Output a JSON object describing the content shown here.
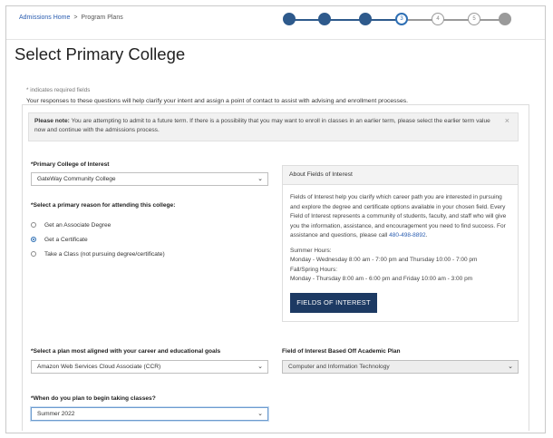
{
  "breadcrumb": {
    "home": "Admissions Home",
    "separator": ">",
    "current": "Program Plans"
  },
  "progress": {
    "steps": [
      {
        "label": "",
        "state": "done"
      },
      {
        "label": "",
        "state": "done"
      },
      {
        "label": "",
        "state": "done"
      },
      {
        "label": "3",
        "state": "current"
      },
      {
        "label": "4",
        "state": "todo"
      },
      {
        "label": "5",
        "state": "todo"
      },
      {
        "label": "",
        "state": "last"
      }
    ]
  },
  "page": {
    "title": "Select Primary College",
    "required_note": "* indicates required fields",
    "intro": "Your responses to these questions will help clarify your intent and assign a point of contact to assist with advising and enrollment processes."
  },
  "notice": {
    "prefix": "Please note:",
    "text": " You are attempting to admit to a future term. If there is a possibility that you may want to enroll in classes in an earlier term, please select the earlier term value now and continue with the admissions process.",
    "close": "×"
  },
  "college": {
    "label": "*Primary College of Interest",
    "value": "GateWay Community College"
  },
  "reason": {
    "label": "*Select a primary reason for attending this college:",
    "options": [
      {
        "label": "Get an Associate Degree",
        "checked": false
      },
      {
        "label": "Get a Certificate",
        "checked": true
      },
      {
        "label": "Take a Class (not pursuing degree/certificate)",
        "checked": false
      }
    ]
  },
  "about": {
    "title": "About Fields of Interest",
    "body": "Fields of Interest help you clarify which career path you are interested in pursuing and explore the degree and certificate options available in your chosen field. Every Field of Interest represents a community of students, faculty, and staff who will give you the information, assistance, and encouragement you need to find success. For assistance and questions, please call ",
    "phone": "480-498-8892",
    "body_end": ".",
    "summer_title": "Summer Hours:",
    "summer_hours": "Monday - Wednesday 8:00 am - 7:00 pm and Thursday 10:00 - 7:00 pm",
    "fall_title": "Fall/Spring Hours:",
    "fall_hours": "Monday - Thursday 8:00 am - 6:00 pm and Friday 10:00 am - 3:00 pm",
    "button": "FIELDS OF INTEREST"
  },
  "plan": {
    "label": "*Select a plan most aligned with your career and educational goals",
    "value": "Amazon Web Services Cloud Associate (CCR)"
  },
  "field": {
    "label": "Field of Interest Based Off Academic Plan",
    "value": "Computer and Information Technology"
  },
  "term": {
    "label": "*When do you plan to begin taking classes?",
    "value": "Summer 2022"
  },
  "icons": {
    "dropdown": "chevron-down-icon",
    "close": "close-icon"
  },
  "colors": {
    "progress_done": "#2e5a8c",
    "progress_current": "#2e6fb4",
    "button_bg": "#1d3a63",
    "link": "#2a5db0"
  }
}
